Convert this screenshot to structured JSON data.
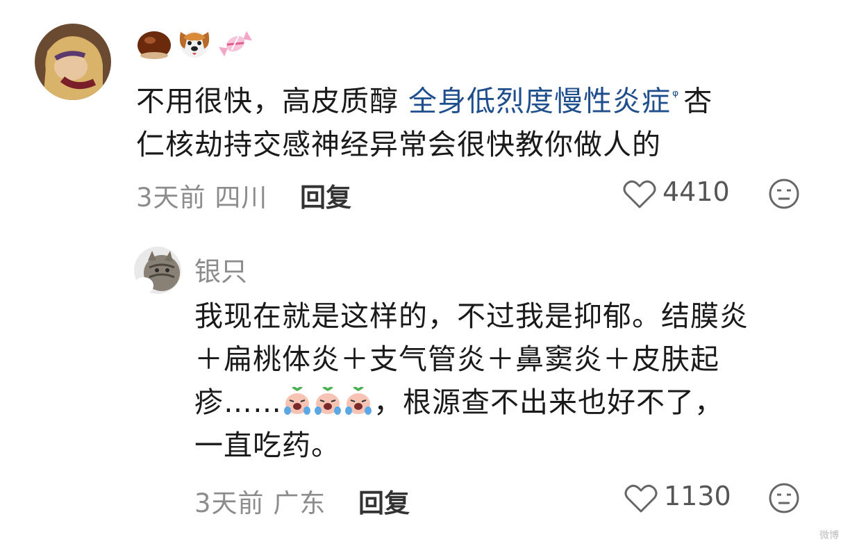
{
  "comments": [
    {
      "username_emojis": [
        "chestnut-icon",
        "dog-face-icon",
        "candy-icon"
      ],
      "text_before": "不用很快，高皮质醇 ",
      "link_text": "全身低烈度慢性炎症",
      "search_mark": "ᵠ",
      "text_after_line1": "杏",
      "text_line2": "仁核劫持交感神经异常会很快教你做人的",
      "time": "3天前",
      "location": "四川",
      "reply_label": "回复",
      "like_count": "4410"
    },
    {
      "username": "银只",
      "text_line1": "我现在就是这样的，不过我是抑郁。结膜炎",
      "text_line2": "＋扁桃体炎＋支气管炎＋鼻窦炎＋皮肤起",
      "text_line3_start": "疹……",
      "text_line3_end": "，根源查不出来也好不了，",
      "text_line4": "一直吃药。",
      "time": "3天前",
      "location": "广东",
      "reply_label": "回复",
      "like_count": "1130"
    }
  ],
  "watermark": "微博"
}
